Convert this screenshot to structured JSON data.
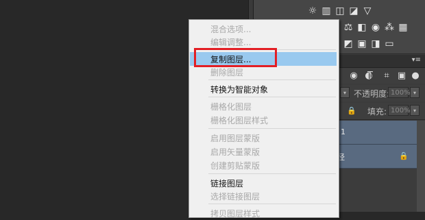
{
  "right_panel": {
    "adjust_icons": [
      [
        "brightness-icon",
        "levels-icon",
        "curves-icon",
        "exposure-icon",
        "vibrance-icon"
      ],
      [
        "hue-icon",
        "balance-icon",
        "bw-icon",
        "photo-filter-icon",
        "channel-mixer-icon",
        "color-lookup-icon"
      ],
      [
        "invert-icon",
        "posterize-icon",
        "threshold-icon",
        "gradient-map-icon",
        "selective-color-icon"
      ]
    ],
    "layers_tab": "径",
    "opacity_label": "不透明度:",
    "opacity_value": "100%",
    "fill_label": "填充:",
    "fill_value": "100%",
    "layer1_name": "1",
    "layer2_name": "径"
  },
  "context_menu": {
    "items": [
      {
        "label": "混合选项...",
        "enabled": false
      },
      {
        "label": "编辑调整...",
        "enabled": false
      },
      {
        "label": "复制图层...",
        "enabled": true,
        "highlighted": true
      },
      {
        "label": "删除图层",
        "enabled": false
      },
      {
        "label": "转换为智能对象",
        "enabled": true
      },
      {
        "label": "栅格化图层",
        "enabled": false
      },
      {
        "label": "栅格化图层样式",
        "enabled": false
      },
      {
        "label": "启用图层蒙版",
        "enabled": false
      },
      {
        "label": "启用矢量蒙版",
        "enabled": false
      },
      {
        "label": "创建剪贴蒙版",
        "enabled": false
      },
      {
        "label": "链接图层",
        "enabled": true
      },
      {
        "label": "选择链接图层",
        "enabled": false
      },
      {
        "label": "拷贝图层样式",
        "enabled": false
      }
    ]
  },
  "colors": {
    "highlight": "#99c9ef",
    "annotation": "#e31e24",
    "layer_selected": "#596a80"
  }
}
